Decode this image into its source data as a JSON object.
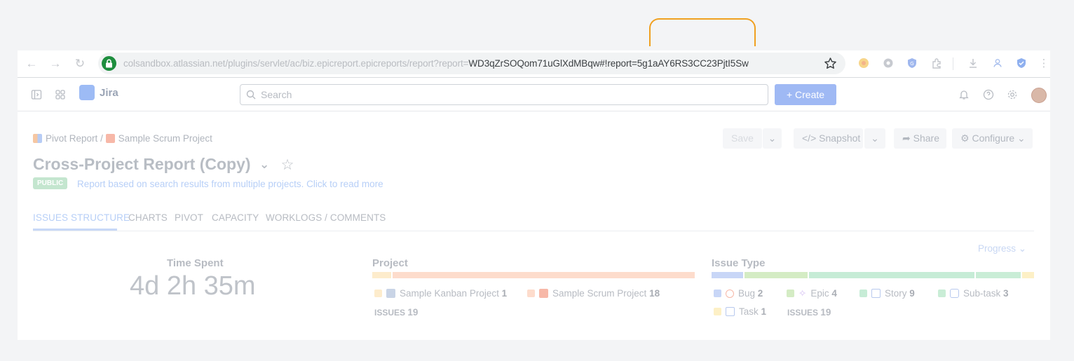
{
  "browser": {
    "url_dim": "colsandbox.atlassian.net/plugins/servlet/ac/biz.epicreport.epicreports/report?report=",
    "url_highlight": "WD3qZrSOQom71uGlXdMBqw#!report=5g1aAY6RS3CC23PjtI5Sw"
  },
  "jira": {
    "app_name": "Jira",
    "search_placeholder": "Search",
    "create_label": "+ Create"
  },
  "breadcrumb": [
    "Pivot Report",
    "Sample Scrum Project"
  ],
  "report": {
    "title": "Cross-Project Report (Copy)",
    "badge": "PUBLIC",
    "subtitle": "Report based on search results from multiple projects. Click to read more"
  },
  "actions": {
    "save": "Save",
    "snapshot": "Snapshot",
    "share": "Share",
    "configure": "Configure"
  },
  "tabs": [
    "ISSUES STRUCTURE",
    "CHARTS",
    "PIVOT",
    "CAPACITY",
    "WORKLOGS / COMMENTS"
  ],
  "progress_label": "Progress",
  "time_spent": {
    "label": "Time Spent",
    "value": "4d 2h 35m"
  },
  "project": {
    "title": "Project",
    "items": [
      {
        "name": "Sample Kanban Project",
        "count": "1"
      },
      {
        "name": "Sample Scrum Project",
        "count": "18"
      }
    ],
    "total_label": "ISSUES",
    "total": "19"
  },
  "issue_type": {
    "title": "Issue Type",
    "items": [
      {
        "name": "Bug",
        "count": "2"
      },
      {
        "name": "Epic",
        "count": "4"
      },
      {
        "name": "Story",
        "count": "9"
      },
      {
        "name": "Sub-task",
        "count": "3"
      },
      {
        "name": "Task",
        "count": "1"
      }
    ],
    "total_label": "ISSUES",
    "total": "19"
  },
  "colors": {
    "accent": "#5b8def",
    "bug": "#c8d6f7",
    "epic": "#d4ecc4",
    "story": "#c6ecd6",
    "subtask": "#c9edd6",
    "task": "#fdf0c6",
    "kanban": "#fdeccc",
    "scrum": "#fddccc"
  }
}
